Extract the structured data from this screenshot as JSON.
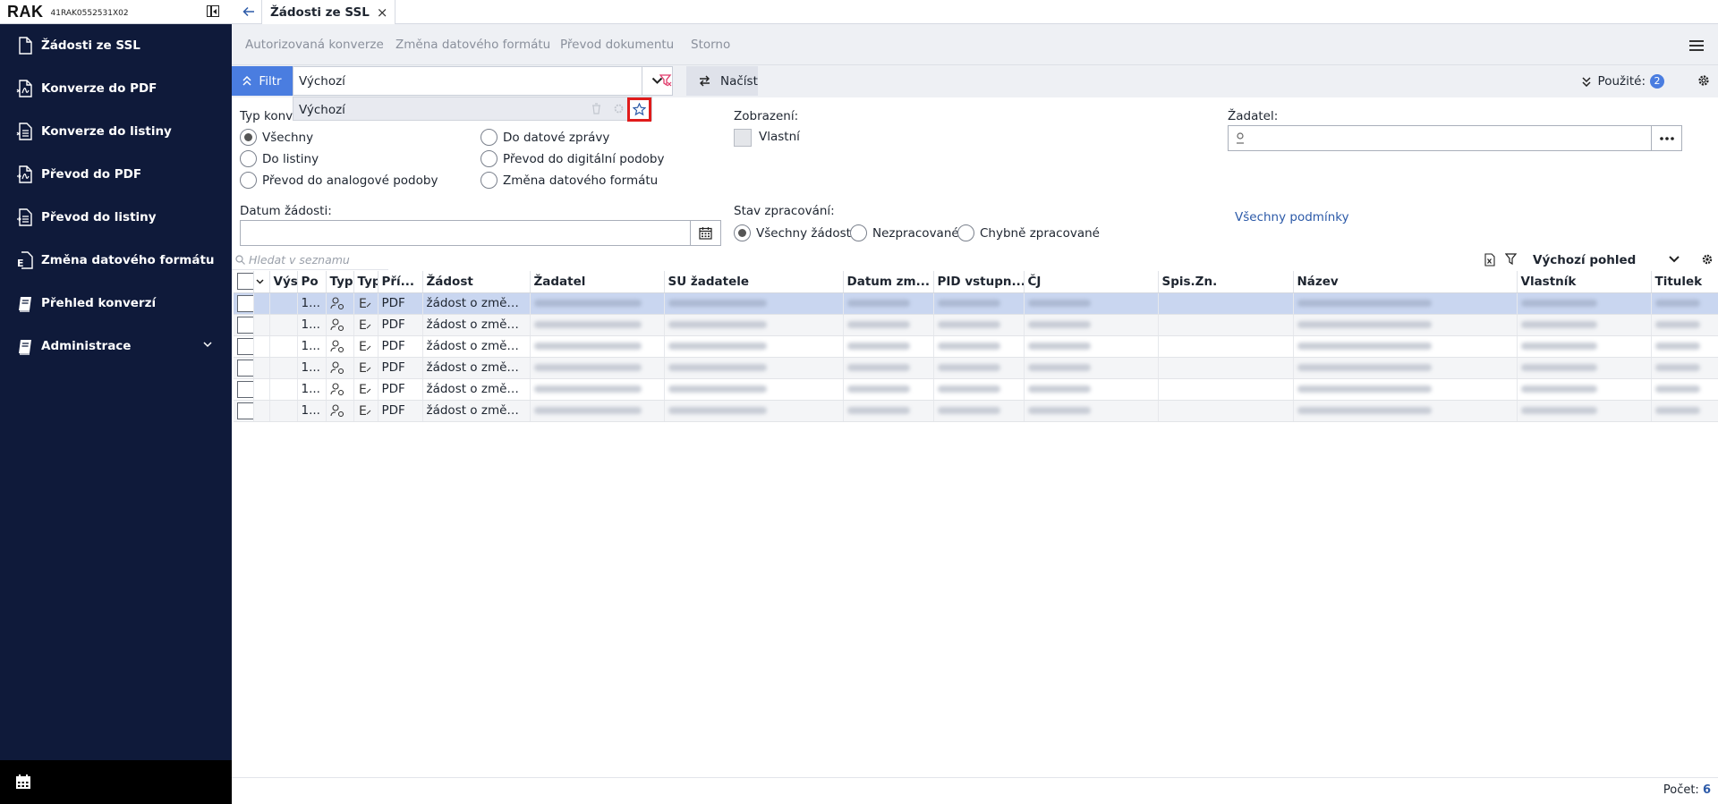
{
  "app": {
    "name": "RAK",
    "instance": "41RAK0552531X02"
  },
  "sidebar": {
    "items": [
      {
        "label": "Žádosti ze SSL",
        "icon": "document-icon"
      },
      {
        "label": "Konverze do PDF",
        "icon": "pdf-convert-icon"
      },
      {
        "label": "Konverze do listiny",
        "icon": "document-list-icon"
      },
      {
        "label": "Převod do PDF",
        "icon": "pdf-transfer-icon"
      },
      {
        "label": "Převod do listiny",
        "icon": "document-transfer-icon"
      },
      {
        "label": "Změna datového formátu",
        "icon": "format-change-icon"
      },
      {
        "label": "Přehled konverzí",
        "icon": "book-icon"
      },
      {
        "label": "Administrace",
        "icon": "book-admin-icon"
      }
    ]
  },
  "tab": {
    "title": "Žádosti ze SSL",
    "close": "×"
  },
  "toolbar": {
    "authorized": "Autorizovaná konverze",
    "format_change": "Změna datového formátu",
    "doc_transfer": "Převod dokumentu",
    "cancel": "Storno"
  },
  "filterbar": {
    "filter_label": "Filtr",
    "selected": "Výchozí",
    "load_label": "Načíst",
    "used_label": "Použité:",
    "used_count": "2",
    "dropdown_item": "Výchozí"
  },
  "filters": {
    "conversion_type_label": "Typ konverze:",
    "conversion_options": [
      "Všechny",
      "Do listiny",
      "Převod do analogové podoby",
      "Do datové zprávy",
      "Převod do digitální podoby",
      "Změna datového formátu"
    ],
    "display_label": "Zobrazení:",
    "own_label": "Vlastní",
    "applicant_label": "Žadatel:",
    "date_label": "Datum žádosti:",
    "state_label": "Stav zpracování:",
    "state_options": [
      "Všechny žádosti",
      "Nezpracované",
      "Chybně zpracované"
    ],
    "all_conditions": "Všechny podmínky"
  },
  "list": {
    "search_placeholder": "Hledat v seznamu",
    "view_label": "Výchozí pohled",
    "columns": [
      "",
      "Výs",
      "Po",
      "Typ",
      "Typ",
      "Pří...",
      "Žádost",
      "Žadatel",
      "SU žadatele",
      "Datum zm...",
      "PID vstupn...",
      "ČJ",
      "Spis.Zn.",
      "Název",
      "Vlastník",
      "Titulek"
    ],
    "rows": [
      {
        "po": "1...",
        "ext": "PDF",
        "request": "žádost o změnu ..."
      },
      {
        "po": "1...",
        "ext": "PDF",
        "request": "žádost o změnu ..."
      },
      {
        "po": "1...",
        "ext": "PDF",
        "request": "žádost o změnu ..."
      },
      {
        "po": "1...",
        "ext": "PDF",
        "request": "žádost o změnu ..."
      },
      {
        "po": "1...",
        "ext": "PDF",
        "request": "žádost o změnu ..."
      },
      {
        "po": "1...",
        "ext": "PDF",
        "request": "žádost o změnu ..."
      }
    ]
  },
  "footer": {
    "count_label": "Počet:",
    "count": "6"
  },
  "colors": {
    "sidebar": "#0f1a3a",
    "accent": "#4a7de0",
    "selected_row": "#c9d6f0",
    "highlight": "#e01b1b"
  }
}
